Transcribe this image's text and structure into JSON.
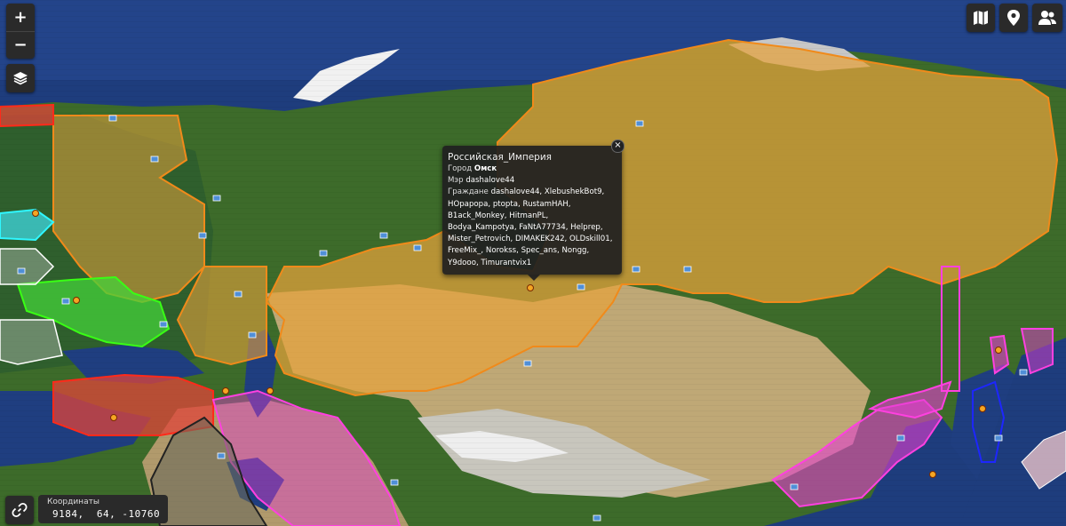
{
  "controls": {
    "zoom_in": "+",
    "zoom_out": "−"
  },
  "popup": {
    "nation": "Российская_Империя",
    "town_label": "Город",
    "town": "Омск",
    "mayor_label": "Мэр",
    "mayor": "dashalove44",
    "residents_label": "Граждане",
    "residents": "dashalove44, XlebushekBot9, HOpapopa, ptopta, RustamHAH, B1ack_Monkey, HitmanPL, Bodya_Kampotya, FaNtA77734, Helprep, Mister_Petrovich, DIMAKEK242, OLDskill01, FreeMix_, Norokss, Spec_ans, Nongg, Y9dooo, Timurantvix1",
    "close": "×"
  },
  "coords": {
    "label": "Координаты",
    "value": "9184,  64, -10760"
  },
  "colors": {
    "ocean": "#1c3a78",
    "russia": "#e6a23c",
    "pink_nation": "#e23fd1",
    "green_nation": "#44d23a",
    "red_nation": "#e0443a",
    "cyan_nation": "#3fd7e0"
  },
  "icons": [
    "plus-icon",
    "minus-icon",
    "layers-icon",
    "map-icon",
    "location-pin-icon",
    "players-icon",
    "link-icon"
  ]
}
